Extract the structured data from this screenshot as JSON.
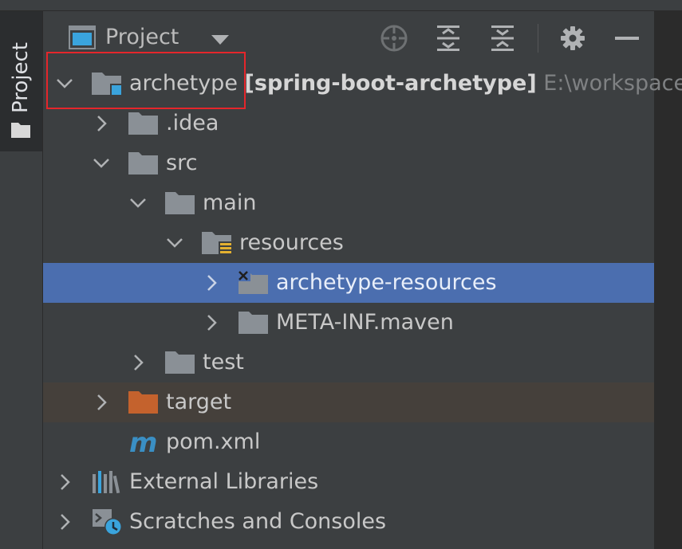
{
  "side_tab": {
    "label": "Project",
    "icon": "folder-icon"
  },
  "toolbar": {
    "title": "Project",
    "view_icon": "project-view-icon",
    "dropdown_icon": "caret-down-icon",
    "buttons": [
      {
        "name": "locate-icon"
      },
      {
        "name": "expand-all-icon"
      },
      {
        "name": "collapse-all-icon"
      },
      {
        "name": "gear-icon"
      },
      {
        "name": "hide-icon"
      }
    ]
  },
  "tree": {
    "root": {
      "name": "archetype",
      "module": "[spring-boot-archetype]",
      "path": "E:\\workspace"
    },
    "items": [
      {
        "label": ".idea"
      },
      {
        "label": "src"
      },
      {
        "label": "main"
      },
      {
        "label": "resources"
      },
      {
        "label": "archetype-resources"
      },
      {
        "label": "META-INF.maven"
      },
      {
        "label": "test"
      },
      {
        "label": "target"
      },
      {
        "label": "pom.xml"
      },
      {
        "label": "External Libraries"
      },
      {
        "label": "Scratches and Consoles"
      }
    ]
  },
  "colors": {
    "selection": "#4b6eaf",
    "excluded_row": "#45403b",
    "folder": "#8a9096",
    "target_folder": "#c4622d",
    "module_accent": "#3aa4dd",
    "maven": "#3a8fc4",
    "highlight": "#e5262b"
  }
}
